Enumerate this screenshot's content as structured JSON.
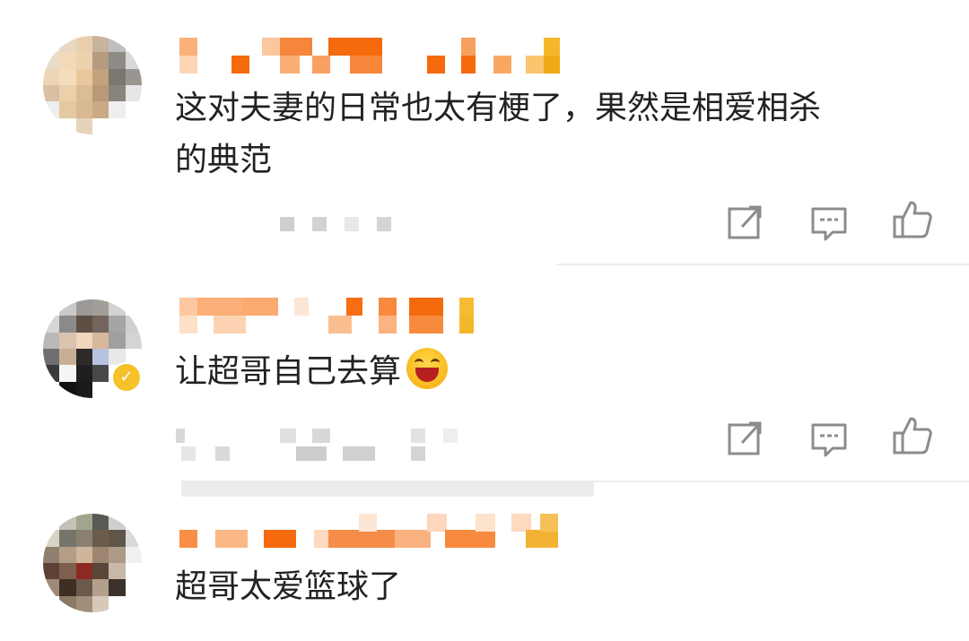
{
  "comments": [
    {
      "username": "",
      "text_line1": "这对夫妻的日常也太有梗了，果然是相爱相杀",
      "text_line2": "的典范",
      "meta": ""
    },
    {
      "username": "",
      "verified": true,
      "text": "让超哥自己去算",
      "emoji": "laughing-emoji",
      "meta": ""
    },
    {
      "username": "",
      "text": "超哥太爱篮球了",
      "meta": ""
    }
  ],
  "actions": {
    "share_icon": "share-icon",
    "reply_icon": "comment-icon",
    "like_icon": "thumbs-up-icon"
  },
  "colors": {
    "username_blur_orange": "#f97a1e",
    "username_blur_light": "#fcc49a",
    "icon_gray": "#8c8c8c",
    "verified_badge": "#f7c12a",
    "text": "#222222"
  }
}
